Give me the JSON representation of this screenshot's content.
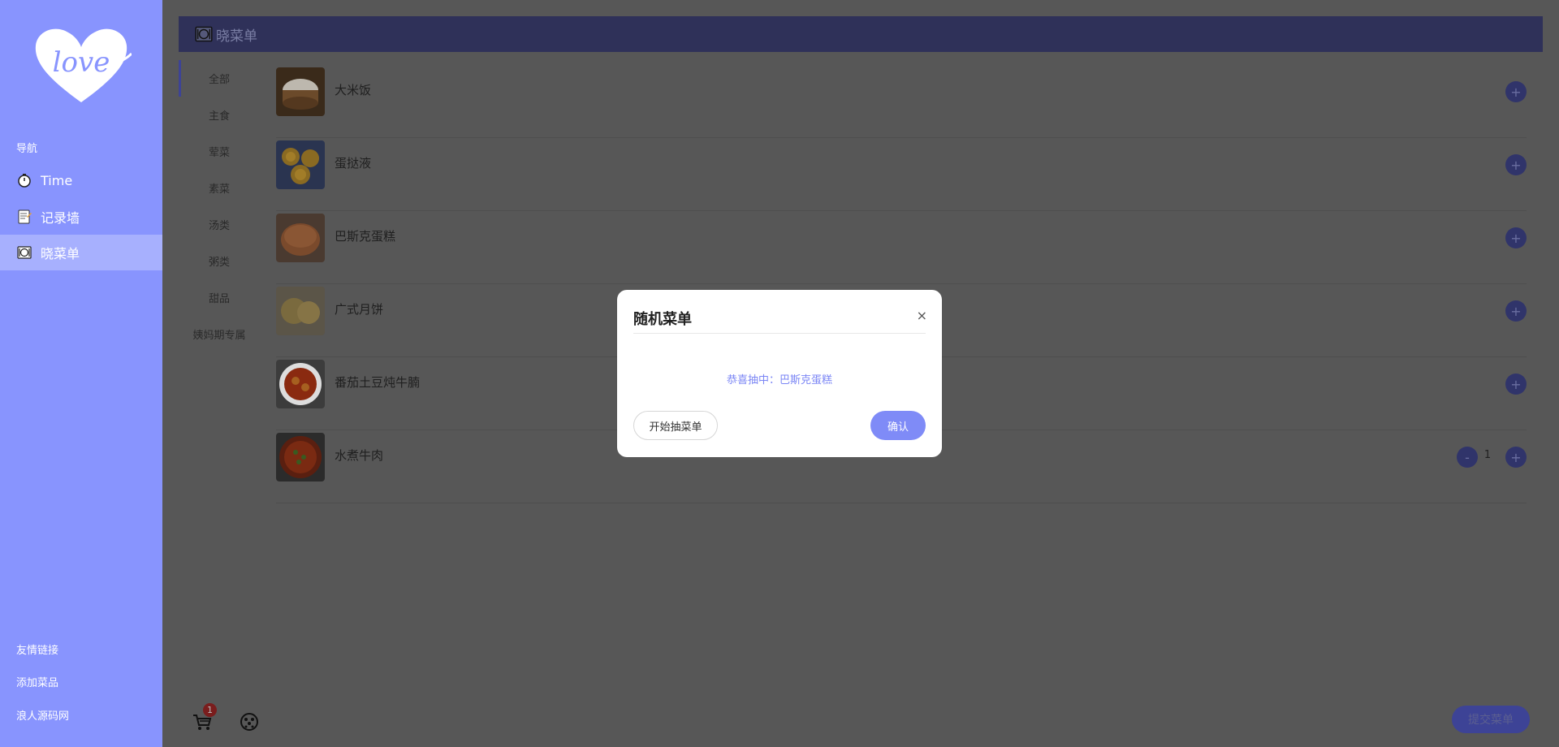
{
  "sidebar": {
    "logo_text": "love",
    "nav_label": "导航",
    "items": [
      {
        "label": "Time",
        "icon": "stopwatch-icon"
      },
      {
        "label": "记录墙",
        "icon": "memo-icon"
      },
      {
        "label": "晓菜单",
        "icon": "plate-icon",
        "active": true
      }
    ],
    "footer_links": [
      "友情链接",
      "添加菜品",
      "浪人源码网"
    ]
  },
  "header": {
    "title": "晓菜单",
    "icon": "plate-icon"
  },
  "categories": [
    "全部",
    "主食",
    "荤菜",
    "素菜",
    "汤类",
    "粥类",
    "甜品",
    "姨妈期专属"
  ],
  "active_category": "全部",
  "dishes": [
    {
      "name": "大米饭"
    },
    {
      "name": "蛋挞液"
    },
    {
      "name": "巴斯克蛋糕"
    },
    {
      "name": "广式月饼"
    },
    {
      "name": "番茄土豆炖牛腩"
    },
    {
      "name": "水煮牛肉",
      "quantity": "1",
      "minus_label": "-"
    }
  ],
  "plus_label": "+",
  "bottom": {
    "cart_count": "1",
    "submit_label": "提交菜单"
  },
  "modal": {
    "title": "随机菜单",
    "close_label": "×",
    "result": "恭喜抽中：巴斯克蛋糕",
    "start_label": "开始抽菜单",
    "confirm_label": "确认"
  },
  "colors": {
    "sidebar_bg": "#8894fe",
    "accent": "#7f8bf7",
    "overlay": "#575757",
    "header_bg": "#2f3159"
  }
}
